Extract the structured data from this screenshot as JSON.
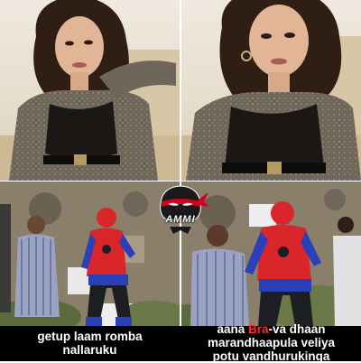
{
  "watermark": {
    "text": "AMMI",
    "icon": "ninja-mask-icon",
    "colors": {
      "mask": "#1a1a1a",
      "band": "#d0021b",
      "text": "#ffffff"
    }
  },
  "panels": {
    "top_left": {
      "icon": "woman-portrait-photo"
    },
    "top_right": {
      "icon": "woman-portrait-photo-zoomed"
    },
    "bottom_left": {
      "icon": "spiderman-costume-scene"
    },
    "bottom_right": {
      "icon": "spiderman-costume-scene-close"
    }
  },
  "captions": {
    "left": {
      "line1": "getup  laam  romba",
      "line2": "nallaruku"
    },
    "right": {
      "line1_pre": "aana ",
      "line1_highlight": "Bra",
      "line1_post": "-va  dhaan",
      "line2": "marandhaapula  veliya",
      "line3": "potu  vandhurukinga"
    }
  },
  "colors": {
    "caption_bg": "#000000",
    "caption_text": "#ffffff",
    "highlight": "#ff2d2d",
    "costume_red": "#d8262a",
    "costume_blue": "#2a3fb8"
  }
}
